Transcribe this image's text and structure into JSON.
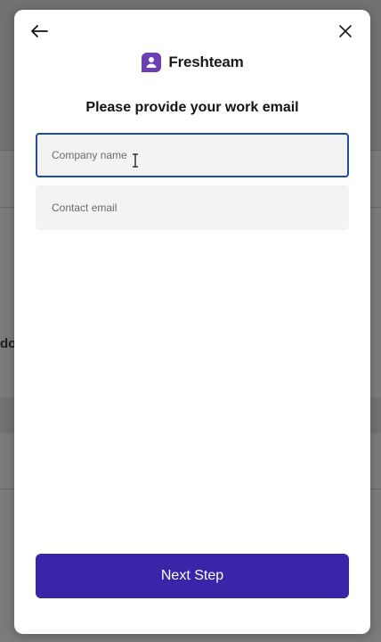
{
  "background": {
    "partial_text": "do"
  },
  "modal": {
    "brand": {
      "name": "Freshteam",
      "logo_icon": "freshteam-logo-icon",
      "logo_color": "#6d3fb5"
    },
    "heading": "Please provide your work email",
    "fields": {
      "company": {
        "placeholder": "Company name",
        "value": ""
      },
      "email": {
        "placeholder": "Contact email",
        "value": ""
      }
    },
    "next_button": {
      "label": "Next Step",
      "color": "#3a24a8"
    },
    "icons": {
      "back": "arrow-left-icon",
      "close": "close-icon"
    },
    "focus_border_color": "#1f4ea0"
  }
}
